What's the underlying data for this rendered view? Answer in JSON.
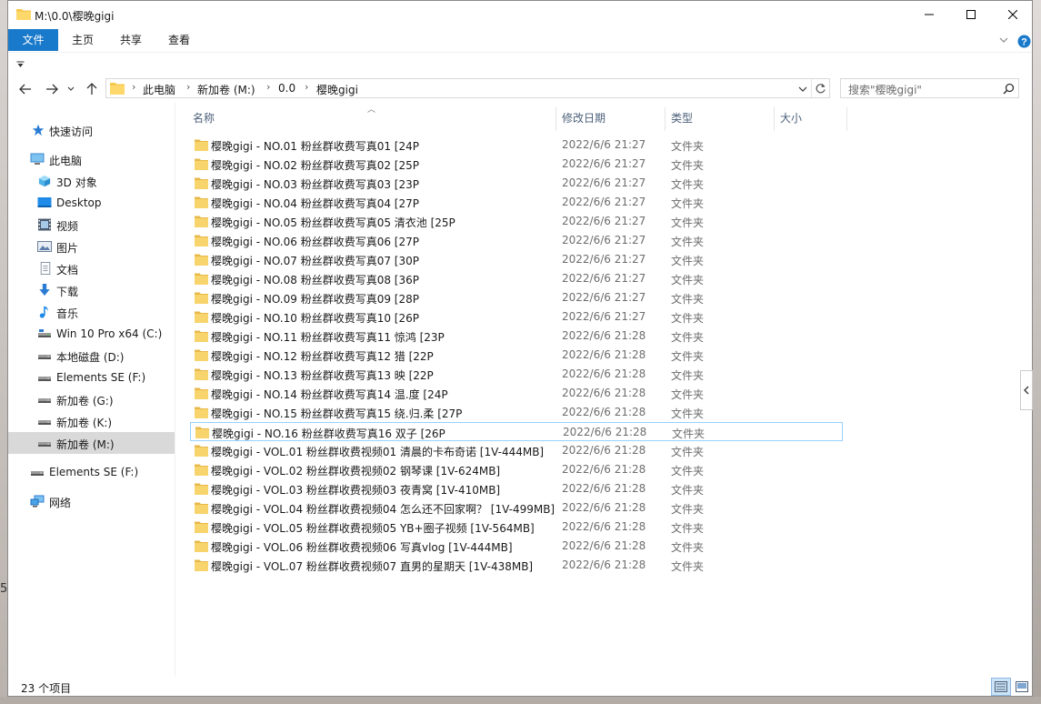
{
  "window": {
    "title": "M:\\0.0\\樱晚gigi",
    "minimize_icon": "minimize-icon",
    "maximize_icon": "maximize-icon",
    "close_icon": "close-icon"
  },
  "ribbon": {
    "tabs": [
      {
        "label": "文件",
        "active": true
      },
      {
        "label": "主页",
        "active": false
      },
      {
        "label": "共享",
        "active": false
      },
      {
        "label": "查看",
        "active": false
      }
    ]
  },
  "address": {
    "crumbs": [
      "此电脑",
      "新加卷 (M:)",
      "0.0",
      "樱晚gigi"
    ],
    "search_placeholder": "搜索\"樱晚gigi\""
  },
  "nav": {
    "items": [
      {
        "label": "快速访问",
        "icon": "star-icon"
      },
      {
        "label": "此电脑",
        "icon": "computer-icon"
      },
      {
        "label": "3D 对象",
        "icon": "cube-icon"
      },
      {
        "label": "Desktop",
        "icon": "desktop-icon"
      },
      {
        "label": "视频",
        "icon": "video-icon"
      },
      {
        "label": "图片",
        "icon": "picture-icon"
      },
      {
        "label": "文档",
        "icon": "document-icon"
      },
      {
        "label": "下载",
        "icon": "download-icon"
      },
      {
        "label": "音乐",
        "icon": "music-icon"
      },
      {
        "label": "Win 10 Pro x64 (C:)",
        "icon": "drive-icon"
      },
      {
        "label": "本地磁盘 (D:)",
        "icon": "drive-icon"
      },
      {
        "label": "Elements SE (F:)",
        "icon": "drive-icon"
      },
      {
        "label": "新加卷 (G:)",
        "icon": "drive-icon"
      },
      {
        "label": "新加卷 (K:)",
        "icon": "drive-icon"
      },
      {
        "label": "新加卷 (M:)",
        "icon": "drive-icon"
      },
      {
        "label": "Elements SE (F:)",
        "icon": "drive-icon"
      },
      {
        "label": "网络",
        "icon": "network-icon"
      }
    ]
  },
  "columns": {
    "name": "名称",
    "date": "修改日期",
    "type": "类型",
    "size": "大小"
  },
  "files": [
    {
      "name": "樱晚gigi - NO.01 粉丝群收费写真01 [24P",
      "date": "2022/6/6 21:27",
      "type": "文件夹"
    },
    {
      "name": "樱晚gigi - NO.02 粉丝群收费写真02 [25P",
      "date": "2022/6/6 21:27",
      "type": "文件夹"
    },
    {
      "name": "樱晚gigi - NO.03 粉丝群收费写真03 [23P",
      "date": "2022/6/6 21:27",
      "type": "文件夹"
    },
    {
      "name": "樱晚gigi - NO.04 粉丝群收费写真04 [27P",
      "date": "2022/6/6 21:27",
      "type": "文件夹"
    },
    {
      "name": "樱晚gigi - NO.05 粉丝群收费写真05 清衣池 [25P",
      "date": "2022/6/6 21:27",
      "type": "文件夹"
    },
    {
      "name": "樱晚gigi - NO.06 粉丝群收费写真06 [27P",
      "date": "2022/6/6 21:27",
      "type": "文件夹"
    },
    {
      "name": "樱晚gigi - NO.07 粉丝群收费写真07 [30P",
      "date": "2022/6/6 21:27",
      "type": "文件夹"
    },
    {
      "name": "樱晚gigi - NO.08 粉丝群收费写真08 [36P",
      "date": "2022/6/6 21:27",
      "type": "文件夹"
    },
    {
      "name": "樱晚gigi - NO.09 粉丝群收费写真09 [28P",
      "date": "2022/6/6 21:27",
      "type": "文件夹"
    },
    {
      "name": "樱晚gigi - NO.10 粉丝群收费写真10 [26P",
      "date": "2022/6/6 21:27",
      "type": "文件夹"
    },
    {
      "name": "樱晚gigi - NO.11 粉丝群收费写真11 惊鸿 [23P",
      "date": "2022/6/6 21:28",
      "type": "文件夹"
    },
    {
      "name": "樱晚gigi - NO.12 粉丝群收费写真12 猎 [22P",
      "date": "2022/6/6 21:28",
      "type": "文件夹"
    },
    {
      "name": "樱晚gigi - NO.13 粉丝群收费写真13 映 [22P",
      "date": "2022/6/6 21:28",
      "type": "文件夹"
    },
    {
      "name": "樱晚gigi - NO.14 粉丝群收费写真14 温.度 [24P",
      "date": "2022/6/6 21:28",
      "type": "文件夹"
    },
    {
      "name": "樱晚gigi - NO.15 粉丝群收费写真15 绕.归.柔 [27P",
      "date": "2022/6/6 21:28",
      "type": "文件夹"
    },
    {
      "name": "樱晚gigi - NO.16 粉丝群收费写真16 双子 [26P",
      "date": "2022/6/6 21:28",
      "type": "文件夹"
    },
    {
      "name": "樱晚gigi - VOL.01 粉丝群收费视频01 清晨的卡布奇诺 [1V-444MB]",
      "date": "2022/6/6 21:28",
      "type": "文件夹"
    },
    {
      "name": "樱晚gigi - VOL.02 粉丝群收费视频02 钢琴课 [1V-624MB]",
      "date": "2022/6/6 21:28",
      "type": "文件夹"
    },
    {
      "name": "樱晚gigi - VOL.03 粉丝群收费视频03 夜青窝 [1V-410MB]",
      "date": "2022/6/6 21:28",
      "type": "文件夹"
    },
    {
      "name": "樱晚gigi - VOL.04 粉丝群收费视频04 怎么还不回家啊？ [1V-499MB]",
      "date": "2022/6/6 21:28",
      "type": "文件夹"
    },
    {
      "name": "樱晚gigi - VOL.05 粉丝群收费视频05 YB+圈子视频 [1V-564MB]",
      "date": "2022/6/6 21:28",
      "type": "文件夹"
    },
    {
      "name": "樱晚gigi - VOL.06 粉丝群收费视频06 写真vlog [1V-444MB]",
      "date": "2022/6/6 21:28",
      "type": "文件夹"
    },
    {
      "name": "樱晚gigi - VOL.07 粉丝群收费视频07 直男的星期天 [1V-438MB]",
      "date": "2022/6/6 21:28",
      "type": "文件夹"
    }
  ],
  "status": {
    "count": "23 个项目"
  },
  "colors": {
    "accent": "#1979ca",
    "folder": "#f5c94c",
    "selection": "#d9d9d9"
  },
  "background": {
    "left_fragment": "5"
  }
}
